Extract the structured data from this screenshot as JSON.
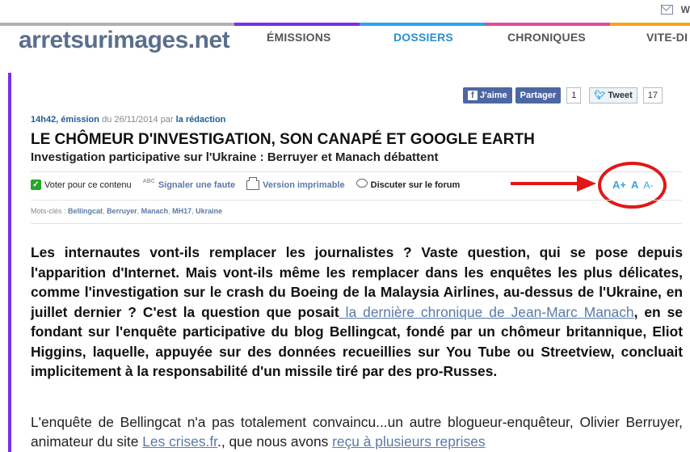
{
  "topbar": {
    "icon_mail": "mail-icon",
    "letter": "W"
  },
  "colorbar": [
    "#b0b0b0",
    "#7a2ee8",
    "#2aa3ef",
    "#e24a9c",
    "#f4a51c"
  ],
  "header": {
    "logo": "arretsurimages.net",
    "nav": [
      {
        "label": "ÉMISSIONS",
        "active": false
      },
      {
        "label": "DOSSIERS",
        "active": true
      },
      {
        "label": "CHRONIQUES",
        "active": false
      },
      {
        "label": "VITE-DI",
        "active": false
      }
    ]
  },
  "social": {
    "like_label": "J'aime",
    "share_label": "Partager",
    "share_count": "1",
    "tweet_label": "Tweet",
    "tweet_count": "17"
  },
  "article": {
    "time": "14h42, émission",
    "date_prefix": "du",
    "date": "26/11/2014",
    "author_prefix": "par",
    "author": "la rédaction",
    "title": "LE CHÔMEUR D'INVESTIGATION, SON CANAPÉ ET GOOGLE EARTH",
    "subtitle": "Investigation participative sur l'Ukraine : Berruyer et Manach débattent",
    "actions": {
      "vote": "Voter pour ce contenu",
      "report": "Signaler une faute",
      "print": "Version imprimable",
      "forum": "Discuter sur le forum"
    },
    "font_size": {
      "bigger": "A+",
      "normal": "A",
      "smaller": "A-"
    },
    "tags_label": "Mots-clés :",
    "tags": [
      "Bellingcat",
      "Berruyer",
      "Manach",
      "MH17",
      "Ukraine"
    ],
    "p1_a": "Les internautes vont-ils remplacer les journalistes ? Vaste question, qui se pose depuis l'apparition d'Internet. Mais vont-ils même les remplacer dans les enquêtes les plus délicates, comme l'investigation sur le crash du Boeing de la Malaysia Airlines, au-dessus de l'Ukraine, en juillet dernier ? C'est la question que posait",
    "p1_link": " la dernière chronique de Jean-Marc Manach",
    "p1_b": ", en se fondant sur l'enquête participative du blog Bellingcat, fondé par un chômeur britannique, Eliot Higgins, laquelle, appuyée sur des données recueillies sur You Tube ou Streetview, concluait implicitement à la responsabilité d'un missile tiré par des pro-Russes.",
    "p2_a": "L'enquête de Bellingcat n'a pas totalement convaincu...un autre blogueur-enquêteur, Olivier Berruyer, animateur du site ",
    "p2_link1": "Les crises.fr",
    "p2_b": "., que nous avons ",
    "p2_link2": "reçu à plusieurs reprises"
  }
}
